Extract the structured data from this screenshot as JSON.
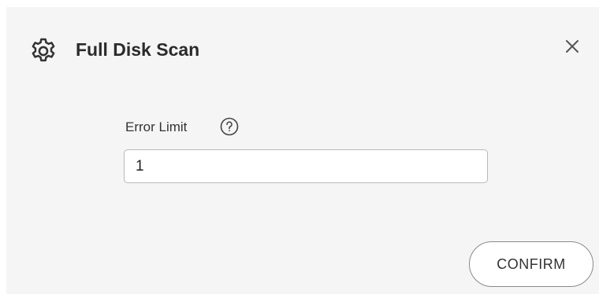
{
  "dialog": {
    "title": "Full Disk Scan",
    "title_icon": "gear-icon",
    "close_icon": "close-icon"
  },
  "form": {
    "error_limit_label": "Error Limit",
    "help_icon": "help-icon",
    "error_limit_value": "1"
  },
  "actions": {
    "confirm_label": "CONFIRM"
  }
}
